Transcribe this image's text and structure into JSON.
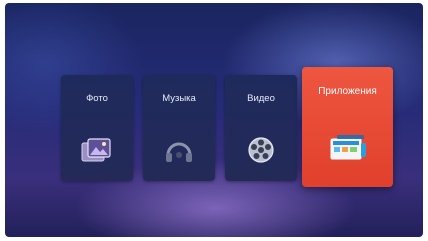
{
  "menu": {
    "items": [
      {
        "label": "Фото",
        "icon": "photo-icon",
        "selected": false
      },
      {
        "label": "Музыка",
        "icon": "music-icon",
        "selected": false
      },
      {
        "label": "Видео",
        "icon": "video-reel-icon",
        "selected": false
      },
      {
        "label": "Приложения",
        "icon": "apps-icon",
        "selected": true
      }
    ]
  },
  "colors": {
    "tile_bg": "#222a5a",
    "selected_tile_bg": "#e8482f",
    "label": "#e7ebf6"
  }
}
